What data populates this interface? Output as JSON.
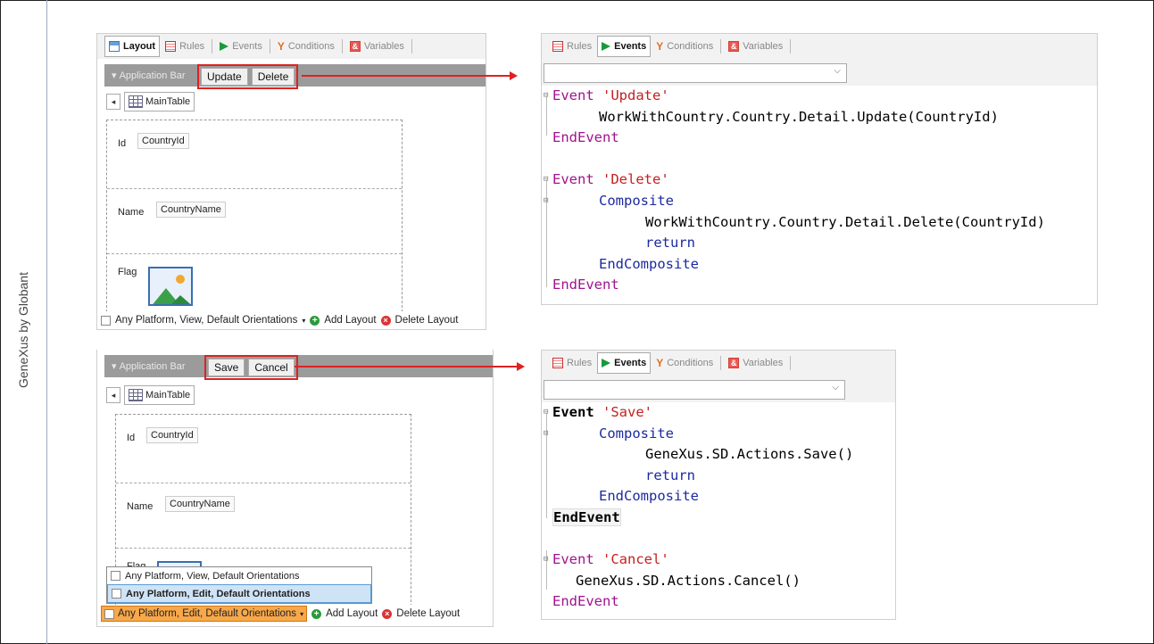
{
  "sidebar": {
    "label": "GeneXus by Globant"
  },
  "tabs_layout": {
    "layout": "Layout",
    "rules": "Rules",
    "events": "Events",
    "conditions": "Conditions",
    "variables": "Variables"
  },
  "panel_top_left": {
    "app_bar": "Application Bar",
    "buttons": [
      "Update",
      "Delete"
    ],
    "main_table": "MainTable",
    "fields": [
      {
        "label": "Id",
        "value": "CountryId"
      },
      {
        "label": "Name",
        "value": "CountryName"
      },
      {
        "label": "Flag"
      }
    ],
    "footer": {
      "layout": "Any Platform, View, Default Orientations",
      "add": "Add Layout",
      "delete": "Delete Layout"
    }
  },
  "panel_bottom_left": {
    "app_bar": "Application Bar",
    "buttons": [
      "Save",
      "Cancel"
    ],
    "main_table": "MainTable",
    "fields": [
      {
        "label": "Id",
        "value": "CountryId"
      },
      {
        "label": "Name",
        "value": "CountryName"
      },
      {
        "label": "Flag"
      }
    ],
    "menu": [
      "Any Platform, View, Default Orientations",
      "Any Platform, Edit, Default Orientations"
    ],
    "footer": {
      "layout": "Any Platform, Edit, Default Orientations",
      "add": "Add Layout",
      "delete": "Delete Layout"
    }
  },
  "code_top": {
    "lines": [
      [
        "Event",
        " 'Update'"
      ],
      [
        "WorkWithCountry.Country.Detail.Update(CountryId)"
      ],
      [
        "EndEvent"
      ],
      [
        "Event",
        " 'Delete'"
      ],
      [
        "Composite"
      ],
      [
        "WorkWithCountry.Country.Detail.Delete(CountryId)"
      ],
      [
        "return"
      ],
      [
        "EndComposite"
      ],
      [
        "EndEvent"
      ]
    ]
  },
  "code_bottom": {
    "lines": [
      [
        "Event",
        " 'Save'"
      ],
      [
        "Composite"
      ],
      [
        "GeneXus.SD.Actions.Save()"
      ],
      [
        "return"
      ],
      [
        "EndComposite"
      ],
      [
        "EndEvent"
      ],
      [
        "Event",
        " 'Cancel'"
      ],
      [
        "GeneXus.SD.Actions.Cancel()"
      ],
      [
        "EndEvent"
      ]
    ]
  },
  "colors": {
    "keyword": "#a0138e",
    "string": "#c42020",
    "blue_kw": "#1c2aa0",
    "highlight": "#d22"
  }
}
